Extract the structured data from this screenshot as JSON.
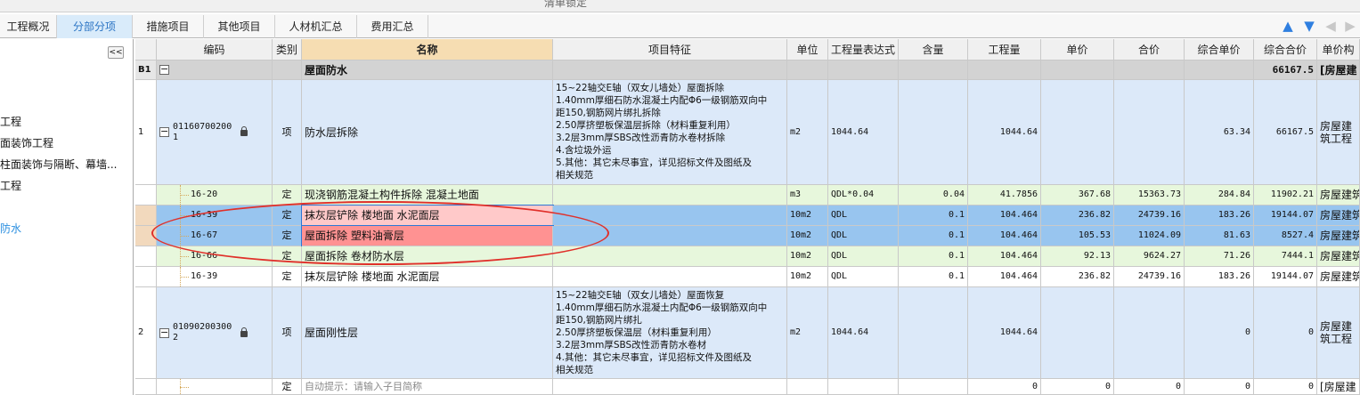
{
  "window_title": "清单锁定",
  "tabs": [
    {
      "label": "工程概况",
      "active": false
    },
    {
      "label": "分部分项",
      "active": true
    },
    {
      "label": "措施项目",
      "active": false
    },
    {
      "label": "其他项目",
      "active": false
    },
    {
      "label": "人材机汇总",
      "active": false
    },
    {
      "label": "费用汇总",
      "active": false
    }
  ],
  "sidebar": {
    "collapse_label": "<<",
    "items": [
      "工程",
      "面装饰工程",
      "柱面装饰与隔断、幕墙...",
      "工程",
      "防水"
    ]
  },
  "columns": [
    "编码",
    "类别",
    "名称",
    "项目特征",
    "单位",
    "工程量表达式",
    "含量",
    "工程量",
    "单价",
    "合价",
    "综合单价",
    "综合合价",
    "单价构"
  ],
  "rows": [
    {
      "seq": "B1",
      "code": "",
      "type": "",
      "name": "屋面防水",
      "feature": "",
      "unit": "",
      "expr": "",
      "content": "",
      "qty": "",
      "price": "",
      "total": "",
      "comp_price": "",
      "comp_total": "66167.5",
      "tail": "[房屋建",
      "style": "section"
    },
    {
      "seq": "1",
      "code": "011607002001",
      "type": "项",
      "name": "防水层拆除",
      "feature": [
        "15~22轴交E轴（双女儿墙处）屋面拆除",
        "1.40mm厚细石防水混凝土内配Φ6一级钢筋双向中",
        "距150,钢筋网片绑扎拆除",
        "2.50厚挤塑板保温层拆除（材料重复利用）",
        "3.2层3mm厚SBS改性沥青防水卷材拆除",
        "4.含垃圾外运",
        "5.其他：其它未尽事宜，详见招标文件及图纸及",
        "相关规范"
      ],
      "unit": "m2",
      "expr": "1044.64",
      "content": "",
      "qty": "1044.64",
      "price": "",
      "total": "",
      "comp_price": "63.34",
      "comp_total": "66167.5",
      "tail": "房屋建筑工程",
      "style": "item"
    },
    {
      "seq": "",
      "code": "16-20",
      "type": "定",
      "name": "现浇钢筋混凝土构件拆除 混凝土地面",
      "feature": "",
      "unit": "m3",
      "expr": "QDL*0.04",
      "content": "0.04",
      "qty": "41.7856",
      "price": "367.68",
      "total": "15363.73",
      "comp_price": "284.84",
      "comp_total": "11902.21",
      "tail": "房屋建筑",
      "style": "green"
    },
    {
      "seq": "",
      "code": "16-39",
      "type": "定",
      "name": "抹灰层铲除 楼地面 水泥面层",
      "feature": "",
      "unit": "10m2",
      "expr": "QDL",
      "content": "0.1",
      "qty": "104.464",
      "price": "236.82",
      "total": "24739.16",
      "comp_price": "183.26",
      "comp_total": "19144.07",
      "tail": "房屋建筑",
      "style": "sel1"
    },
    {
      "seq": "",
      "code": "16-67",
      "type": "定",
      "name": "屋面拆除 塑料油膏层",
      "feature": "",
      "unit": "10m2",
      "expr": "QDL",
      "content": "0.1",
      "qty": "104.464",
      "price": "105.53",
      "total": "11024.09",
      "comp_price": "81.63",
      "comp_total": "8527.4",
      "tail": "房屋建筑",
      "style": "sel2"
    },
    {
      "seq": "",
      "code": "16-66",
      "type": "定",
      "name": "屋面拆除 卷材防水层",
      "feature": "",
      "unit": "10m2",
      "expr": "QDL",
      "content": "0.1",
      "qty": "104.464",
      "price": "92.13",
      "total": "9624.27",
      "comp_price": "71.26",
      "comp_total": "7444.1",
      "tail": "房屋建筑",
      "style": "green"
    },
    {
      "seq": "",
      "code": "16-39",
      "type": "定",
      "name": "抹灰层铲除 楼地面 水泥面层",
      "feature": "",
      "unit": "10m2",
      "expr": "QDL",
      "content": "0.1",
      "qty": "104.464",
      "price": "236.82",
      "total": "24739.16",
      "comp_price": "183.26",
      "comp_total": "19144.07",
      "tail": "房屋建筑",
      "style": "white"
    },
    {
      "seq": "2",
      "code": "010902003002",
      "type": "项",
      "name": "屋面刚性层",
      "feature": [
        "15~22轴交E轴（双女儿墙处）屋面恢复",
        "1.40mm厚细石防水混凝土内配Φ6一级钢筋双向中",
        "距150,钢筋网片绑扎",
        "2.50厚挤塑板保温层（材料重复利用）",
        "3.2层3mm厚SBS改性沥青防水卷材",
        "4.其他：其它未尽事宜，详见招标文件及图纸及",
        "相关规范"
      ],
      "unit": "m2",
      "expr": "1044.64",
      "content": "",
      "qty": "1044.64",
      "price": "",
      "total": "",
      "comp_price": "0",
      "comp_total": "0",
      "tail": "房屋建筑工程",
      "style": "item"
    },
    {
      "seq": "",
      "code": "",
      "type": "定",
      "name": "自动提示：请输入子目简称",
      "feature": "",
      "unit": "",
      "expr": "",
      "content": "",
      "qty": "0",
      "price": "0",
      "total": "0",
      "comp_price": "0",
      "comp_total": "0",
      "tail": "[房屋建",
      "style": "blank"
    }
  ],
  "colors": {
    "section": "#d3d3d3",
    "item": "#dce9f9",
    "green": "#e7f7dc",
    "sel": "#98c5ef",
    "sel_name1": "#ffc9c9",
    "sel_name2": "#ff9292",
    "annotation": "#e0302a",
    "tab_active": "#d9ebfa"
  },
  "icons": [
    "up-arrow-icon",
    "down-arrow-icon",
    "left-arrow-icon",
    "right-arrow-icon",
    "lock-icon",
    "collapse-icon"
  ]
}
